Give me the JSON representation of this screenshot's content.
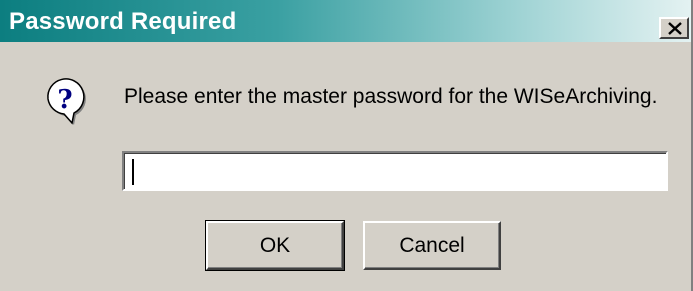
{
  "window": {
    "title": "Password Required",
    "close_icon": "close-x-icon"
  },
  "message": {
    "icon": "question-help-icon",
    "text": "Please enter the master password for the WISeArchiving."
  },
  "password_field": {
    "value": "",
    "placeholder": ""
  },
  "buttons": {
    "ok_label": "OK",
    "cancel_label": "Cancel"
  },
  "colors": {
    "titlebar_start": "#0c7e80",
    "titlebar_end": "#e4f2f2",
    "face": "#d4d0c8"
  }
}
